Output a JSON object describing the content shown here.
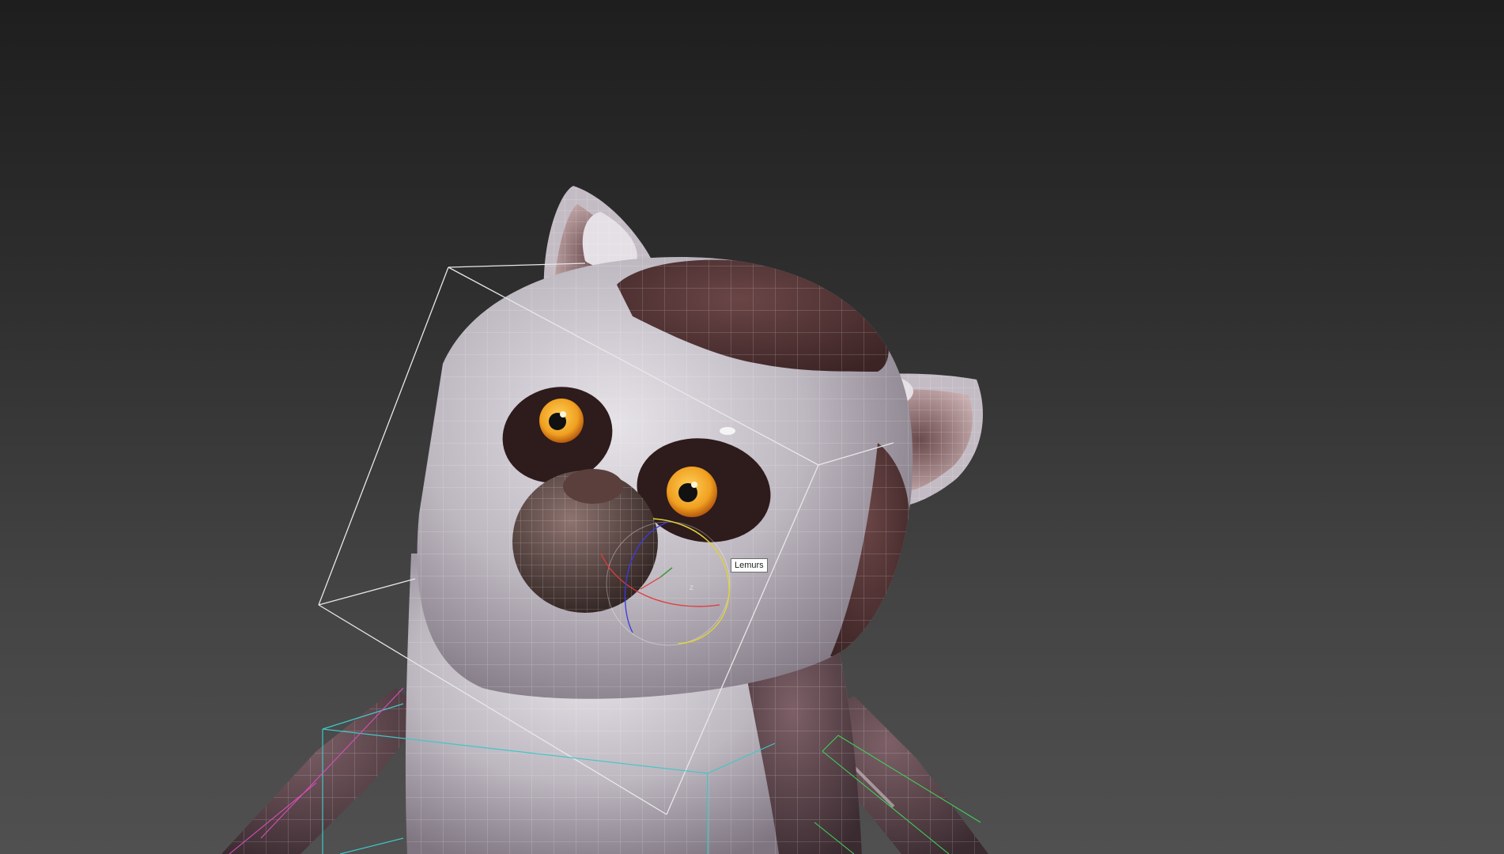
{
  "viewport": {
    "background_top": "#1e1e1e",
    "background_bottom": "#505050"
  },
  "selection": {
    "tooltip_label": "Lemurs",
    "gizmo_axis_label": "z"
  },
  "colors": {
    "fur_light": "#c9c5cc",
    "fur_dark": "#4e2f30",
    "eye_iris": "#f0a020",
    "bounding_box": "#e8e8e8",
    "bone_cyan": "#3fc7c7",
    "bone_green": "#3fcf5a",
    "bone_magenta": "#d84fb8",
    "gizmo_x": "#e03a3a",
    "gizmo_y": "#3a9a3a",
    "gizmo_z": "#3a3ae0",
    "gizmo_rotate": "#e0d23a"
  }
}
